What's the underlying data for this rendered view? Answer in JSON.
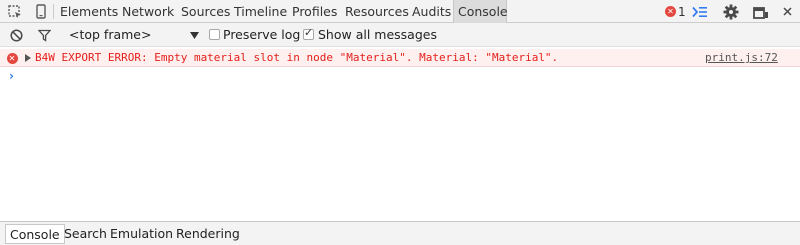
{
  "toolbar": {
    "tabs": [
      "Elements",
      "Network",
      "Sources",
      "Timeline",
      "Profiles",
      "Resources",
      "Audits",
      "Console"
    ],
    "selected_tab": "Console",
    "error_count": "1",
    "icons": [
      "inspect-element-icon",
      "device-mode-icon",
      "drawer-toggle-icon",
      "settings-gear-icon",
      "dock-side-icon",
      "close-icon"
    ]
  },
  "filterbar": {
    "context_select": "<top frame>",
    "preserve_log_label": "Preserve log",
    "preserve_log_checked": false,
    "show_all_label": "Show all messages",
    "show_all_checked": true
  },
  "console": {
    "messages": [
      {
        "level": "error",
        "text": "B4W EXPORT ERROR: Empty material slot in node \"Material\". Material: \"Material\".",
        "source": "print.js:72"
      }
    ],
    "prompt_symbol": "›"
  },
  "drawer": {
    "tabs": [
      "Console",
      "Search",
      "Emulation",
      "Rendering"
    ],
    "selected_tab": "Console"
  },
  "colors": {
    "error_red": "#e3201b",
    "prompt_blue": "#367cf1",
    "toolbar_bg": "#f3f3f3"
  }
}
